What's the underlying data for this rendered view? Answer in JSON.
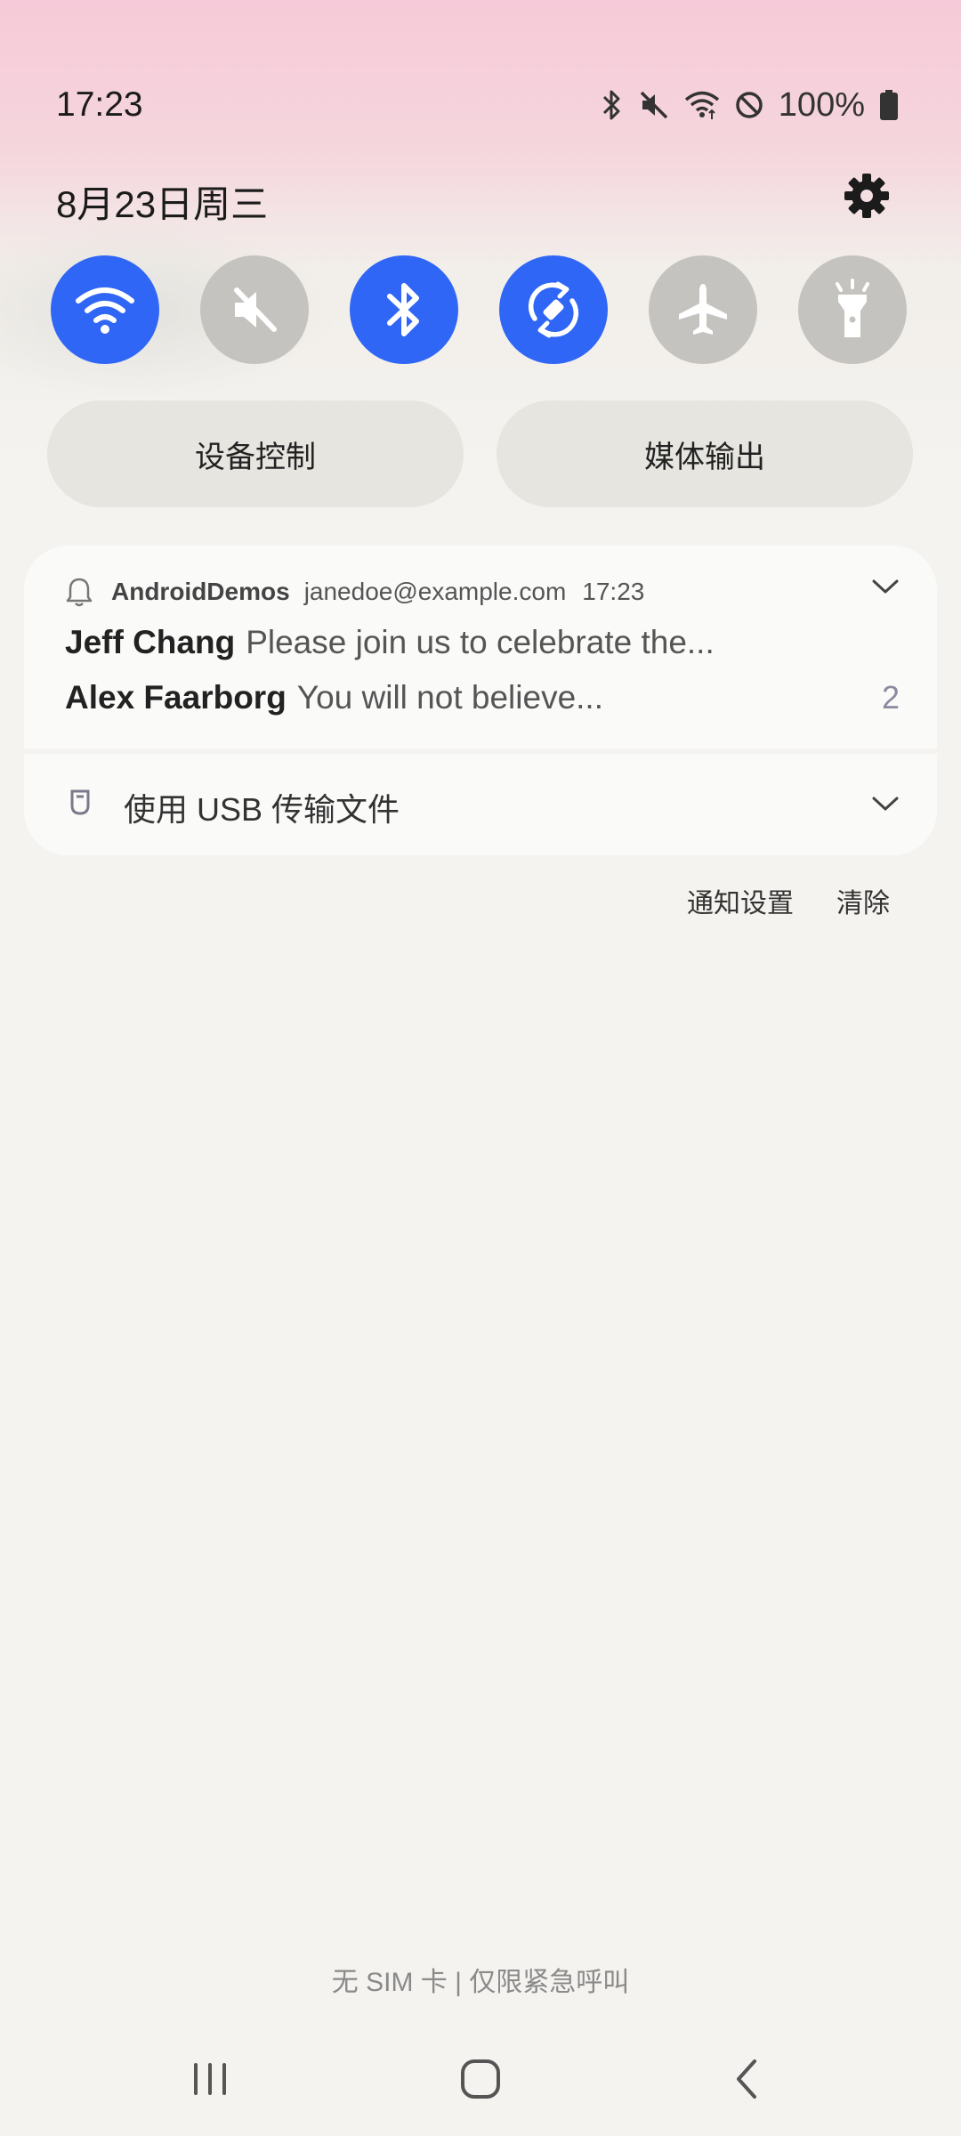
{
  "status_bar": {
    "time": "17:23",
    "battery": "100%"
  },
  "header": {
    "date": "8月23日周三"
  },
  "quick_toggles": [
    {
      "name": "wifi",
      "state": "on"
    },
    {
      "name": "sound-muted",
      "state": "off"
    },
    {
      "name": "bluetooth",
      "state": "on"
    },
    {
      "name": "auto-rotate",
      "state": "on"
    },
    {
      "name": "airplane-mode",
      "state": "off"
    },
    {
      "name": "flashlight",
      "state": "off"
    }
  ],
  "controls": {
    "device_control": "设备控制",
    "media_output": "媒体输出"
  },
  "notification": {
    "app": "AndroidDemos",
    "account": "janedoe@example.com",
    "time": "17:23",
    "messages": [
      {
        "sender": "Jeff Chang",
        "text": "Please join us to celebrate the..."
      },
      {
        "sender": "Alex Faarborg",
        "text": "You will not believe..."
      }
    ],
    "count": "2"
  },
  "usb_notification": {
    "text": "使用 USB 传输文件"
  },
  "actions": {
    "settings": "通知设置",
    "clear": "清除"
  },
  "footer": {
    "sim_status": "无 SIM 卡 | 仅限紧急呼叫"
  },
  "colors": {
    "accent": "#2f66f5",
    "toggle_off": "#c4c3bf",
    "pill_bg": "#e6e5e0"
  }
}
